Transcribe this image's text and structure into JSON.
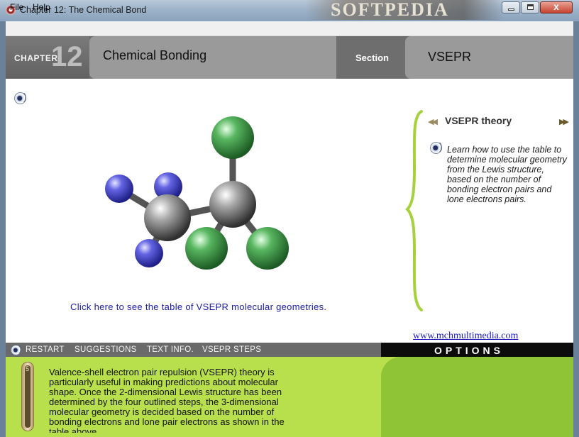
{
  "window": {
    "title": "Chapter 12: The Chemical Bond",
    "watermark": "SOFTPEDIA",
    "close_glyph": "x"
  },
  "menu": {
    "items": [
      "File",
      "Help"
    ]
  },
  "header": {
    "chapter_label": "CHAPTER",
    "chapter_number": "12",
    "topic": "Chemical Bonding",
    "section_label": "Section",
    "section_value": "VSEPR"
  },
  "main": {
    "link_text": "Click here to see the table of VSEPR molecular geometries."
  },
  "sidebar": {
    "prev_icon": "double-arrow-left-icon",
    "next_icon": "double-arrow-right-icon",
    "title": "VSEPR theory",
    "description": "Learn how to use the table to determine molecular geometry from the Lewis structure, based on the number of bonding electron pairs and lone electrons pairs."
  },
  "website": "www.mchmultimedia.com",
  "toolbar": {
    "items": [
      "RESTART",
      "SUGGESTIONS",
      "TEXT INFO.",
      "VSEPR STEPS"
    ],
    "options_label": "OPTIONS"
  },
  "info_panel": {
    "scroll_number": "5",
    "text": "Valence-shell electron pair repulsion (VSEPR) theory is particularly useful in making predictions about molecular shape. Once the 2-dimensional Lewis structure has been determined by the four outlined steps, the 3-dimensional molecular geometry is decided based on the number of bonding electrons and lone pair electrons as shown in the table above."
  },
  "colors": {
    "header_gray": "#6e6e6e",
    "panel_lime": "#b8e04c",
    "options_green": "#8fc437",
    "link_blue": "#1a1aa6",
    "atom_carbon": "#8a8a8a",
    "atom_hydrogen": "#4a4ad0",
    "atom_chlorine": "#3f9a48"
  }
}
